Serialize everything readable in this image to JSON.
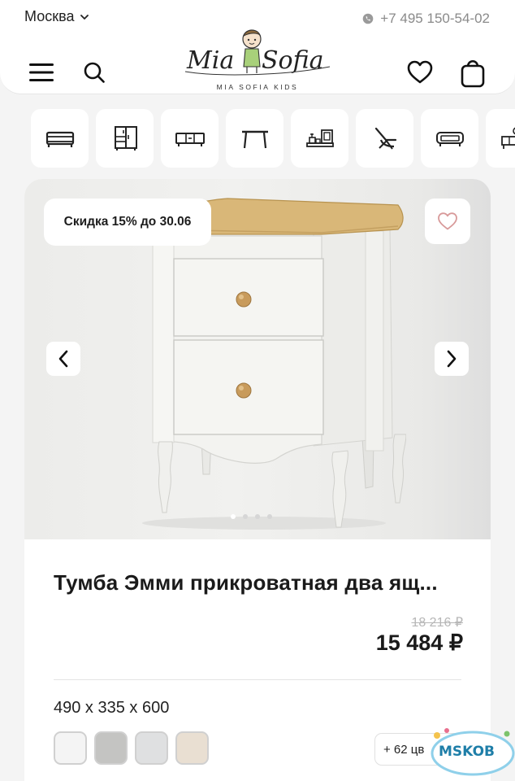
{
  "header": {
    "city": "Москва",
    "phone": "+7 495 150-54-02",
    "logo_script": "Mia Sofia",
    "logo_caption": "MIA SOFIA KIDS"
  },
  "categories": [
    {
      "icon": "bed-icon"
    },
    {
      "icon": "wardrobe-icon"
    },
    {
      "icon": "tv-stand-icon"
    },
    {
      "icon": "table-icon"
    },
    {
      "icon": "shelf-decor-icon"
    },
    {
      "icon": "chair-icon"
    },
    {
      "icon": "sofa-icon"
    },
    {
      "icon": "vanity-icon"
    }
  ],
  "product": {
    "badge": "Скидка 15% до 30.06",
    "title": "Тумба Эмми прикроватная два ящ...",
    "old_price": "18 216 ₽",
    "price": "15 484 ₽",
    "dimensions": "490 х 335 х 600",
    "more_colors": "+ 62 цв",
    "swatches": [
      "#f4f4f4",
      "#c4c4c2",
      "#dfe0e1",
      "#e9dfd2"
    ]
  },
  "gallery": {
    "slide_count": 4,
    "active_slide": 1
  },
  "watermark": "MSKOB",
  "colors": {
    "accent_heart": "#d89a9a",
    "wood_top": "#d9b778",
    "furniture_white": "#f1f1ee"
  }
}
